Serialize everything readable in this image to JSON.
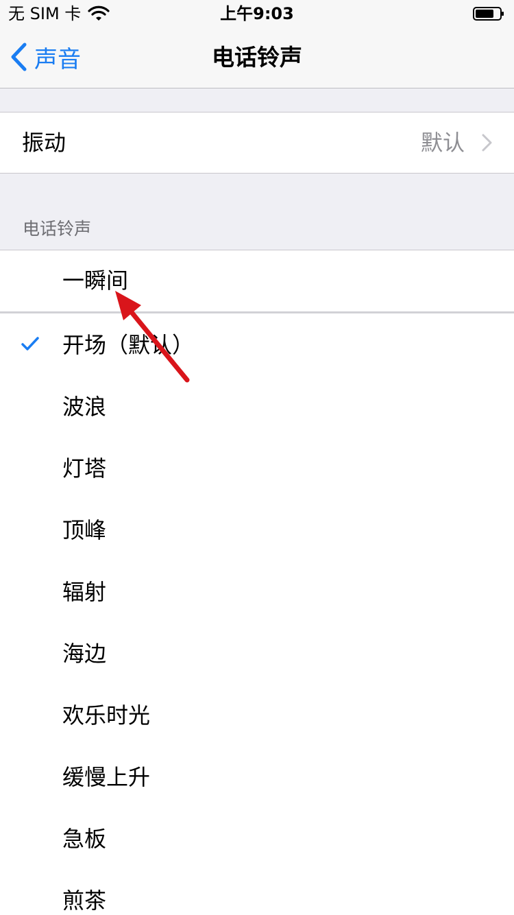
{
  "status_bar": {
    "carrier": "无 SIM 卡",
    "time": "上午9:03"
  },
  "nav": {
    "back_label": "声音",
    "title": "电话铃声"
  },
  "vibration": {
    "label": "振动",
    "value": "默认"
  },
  "ringtone_section": {
    "header": "电话铃声",
    "top_item": "一瞬间",
    "items": [
      {
        "label": "开场（默认）",
        "selected": true
      },
      {
        "label": "波浪",
        "selected": false
      },
      {
        "label": "灯塔",
        "selected": false
      },
      {
        "label": "顶峰",
        "selected": false
      },
      {
        "label": "辐射",
        "selected": false
      },
      {
        "label": "海边",
        "selected": false
      },
      {
        "label": "欢乐时光",
        "selected": false
      },
      {
        "label": "缓慢上升",
        "selected": false
      },
      {
        "label": "急板",
        "selected": false
      },
      {
        "label": "煎茶",
        "selected": false
      }
    ]
  },
  "colors": {
    "accent": "#1a7df2",
    "annotation_arrow": "#d9151b"
  }
}
